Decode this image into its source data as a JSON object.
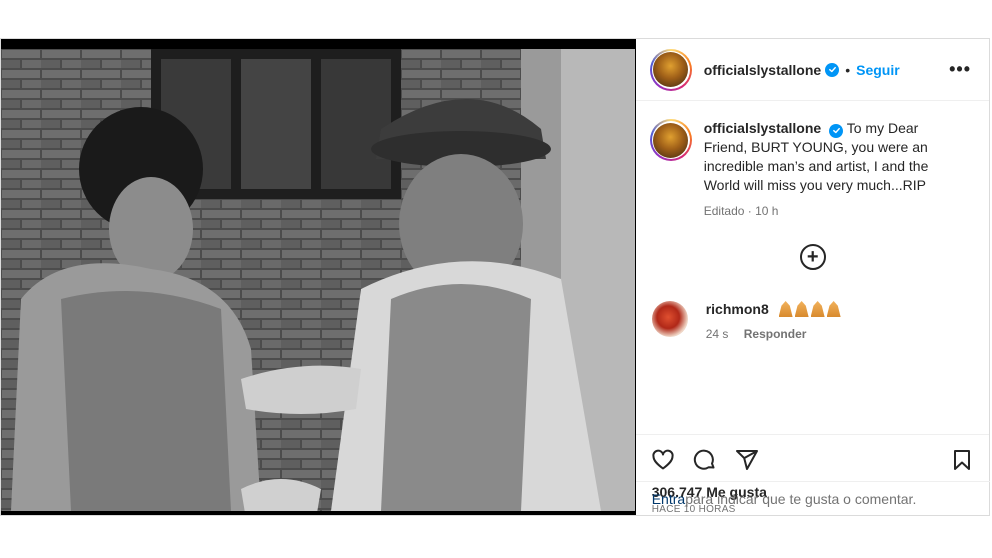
{
  "post": {
    "author": "officialslystallone",
    "follow_label": "Seguir",
    "more_label": "•••",
    "caption_text": "To my Dear Friend, BURT YOUNG, you were an incredible man’s and artist, I and the World will miss you very much...RIP",
    "caption_meta": "Editado · 10 h",
    "comments": [
      {
        "user": "richmon8",
        "emoji_count": 4,
        "time": "24 s",
        "reply_label": "Responder"
      }
    ],
    "likes": "306.747 Me gusta",
    "posted": "HACE 10 HORAS",
    "add_comment_link": "Entra",
    "add_comment_text": " para indicar que te gusta o comentar."
  },
  "icons": {
    "verified": "verified-badge-icon",
    "like": "heart-icon",
    "comment": "comment-bubble-icon",
    "share": "paper-plane-icon",
    "save": "bookmark-icon",
    "load_more": "plus-circle-icon"
  },
  "colors": {
    "link_blue": "#0095f6",
    "text": "#262626",
    "muted": "#737373",
    "border": "#dbdbdb"
  }
}
